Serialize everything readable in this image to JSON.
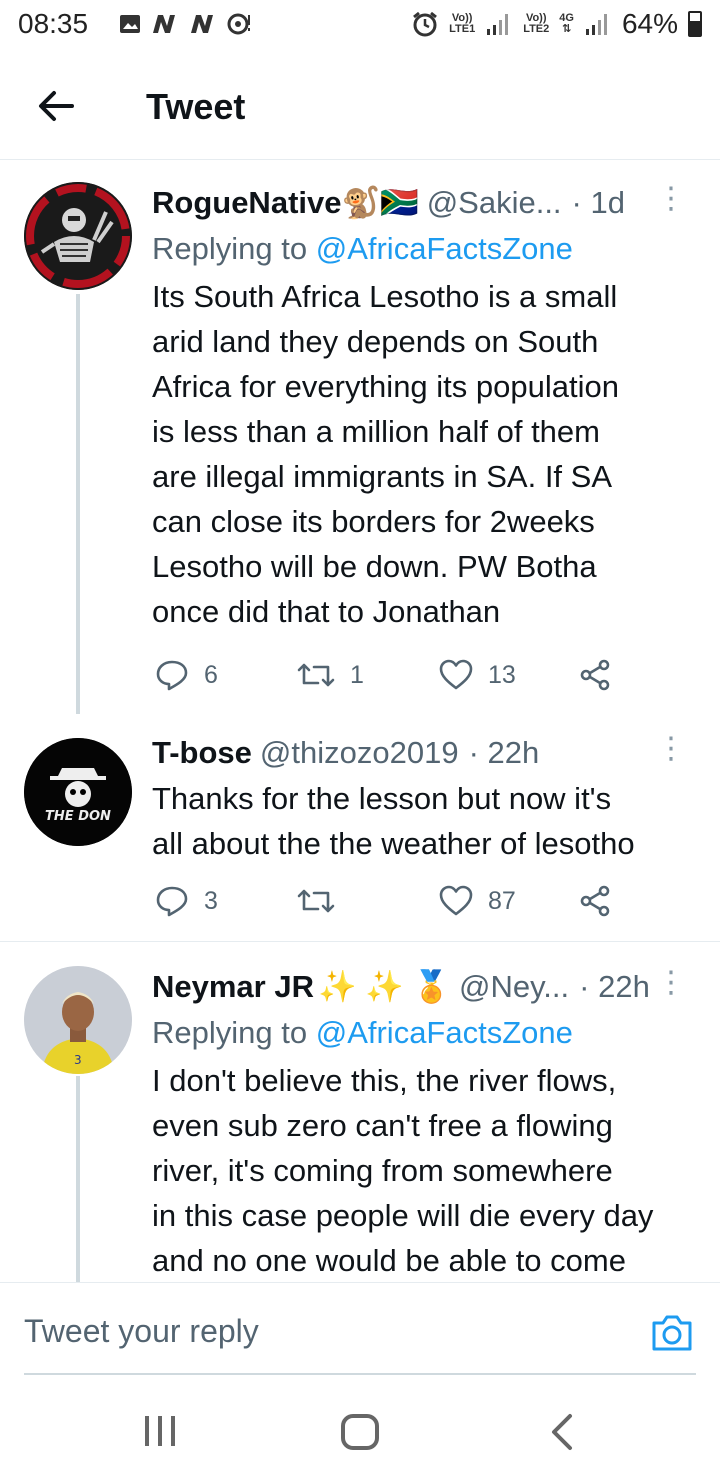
{
  "status_bar": {
    "time": "08:35",
    "volte1": "Vo))",
    "lte1": "LTE1",
    "volte2": "Vo))",
    "lte2": "LTE2",
    "network": "4G",
    "battery": "64%"
  },
  "header": {
    "title": "Tweet"
  },
  "tweets": [
    {
      "name": "RogueNative",
      "emoji": "🐒🇿🇦",
      "handle": "@Sakie...",
      "time": "· 1d",
      "reply_prefix": "Replying to ",
      "reply_to": "@AfricaFactsZone",
      "text": "Its South Africa Lesotho is a small\narid land they depends on South\nAfrica for everything its population\nis less than a million half of them\nare illegal immigrants in SA. If SA\ncan close its borders for 2weeks\nLesotho will be down. PW Botha\nonce did that to Jonathan",
      "replies": "6",
      "retweets": "1",
      "likes": "13"
    },
    {
      "name": "T-bose",
      "handle": "@thizozo2019",
      "time": "· 22h",
      "text": "Thanks for the lesson but now it's\nall about the the weather of lesotho",
      "replies": "3",
      "retweets": "",
      "likes": "87",
      "avatar_text": "THE DON"
    },
    {
      "name": "Neymar JR",
      "emoji": "✨ ✨ 🏅",
      "handle": "@Ney...",
      "time": "· 22h",
      "reply_prefix": "Replying to ",
      "reply_to": "@AfricaFactsZone",
      "text": "I don't believe this, the river flows,\neven sub zero can't free a flowing\nriver, it's coming from somewhere\nin this case people will die every day\nand no one would be able to come"
    }
  ],
  "reply_bar": {
    "placeholder": "Tweet your reply"
  },
  "colors": {
    "accent": "#1d9bf0",
    "text": "#0f1419",
    "muted": "#536471",
    "divider": "#e6ecf0"
  }
}
